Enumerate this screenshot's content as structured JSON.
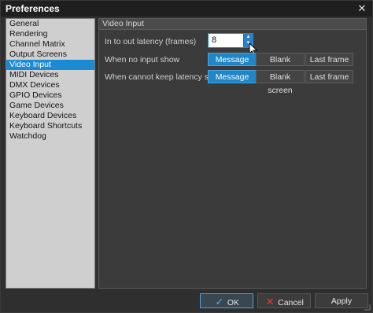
{
  "window": {
    "title": "Preferences",
    "close_symbol": "✕"
  },
  "sidebar": {
    "items": [
      {
        "label": "General"
      },
      {
        "label": "Rendering"
      },
      {
        "label": "Channel Matrix"
      },
      {
        "label": "Output Screens"
      },
      {
        "label": "Video Input",
        "selected": true
      },
      {
        "label": "MIDI Devices"
      },
      {
        "label": "DMX Devices"
      },
      {
        "label": "GPIO Devices"
      },
      {
        "label": "Game Devices"
      },
      {
        "label": "Keyboard Devices"
      },
      {
        "label": "Keyboard Shortcuts"
      },
      {
        "label": "Watchdog"
      }
    ]
  },
  "panel": {
    "group_title": "Video Input",
    "latency": {
      "label": "In to out latency (frames)",
      "value": "8"
    },
    "no_input": {
      "label": "When no input show",
      "options": [
        "Message",
        "Blank screen",
        "Last frame"
      ],
      "selected": "Message"
    },
    "cannot_keep": {
      "label": "When cannot keep latency show",
      "options": [
        "Message",
        "Blank screen",
        "Last frame"
      ],
      "selected": "Message"
    }
  },
  "footer": {
    "ok_label": "OK",
    "cancel_label": "Cancel",
    "apply_label": "Apply"
  },
  "colors": {
    "accent": "#1f86c8",
    "selection": "#1a8ad3",
    "ok_icon": "#3db7ff",
    "cancel_icon": "#e23b2f"
  },
  "icons": {
    "ok": "check-icon",
    "cancel": "x-icon",
    "close": "close-icon"
  }
}
